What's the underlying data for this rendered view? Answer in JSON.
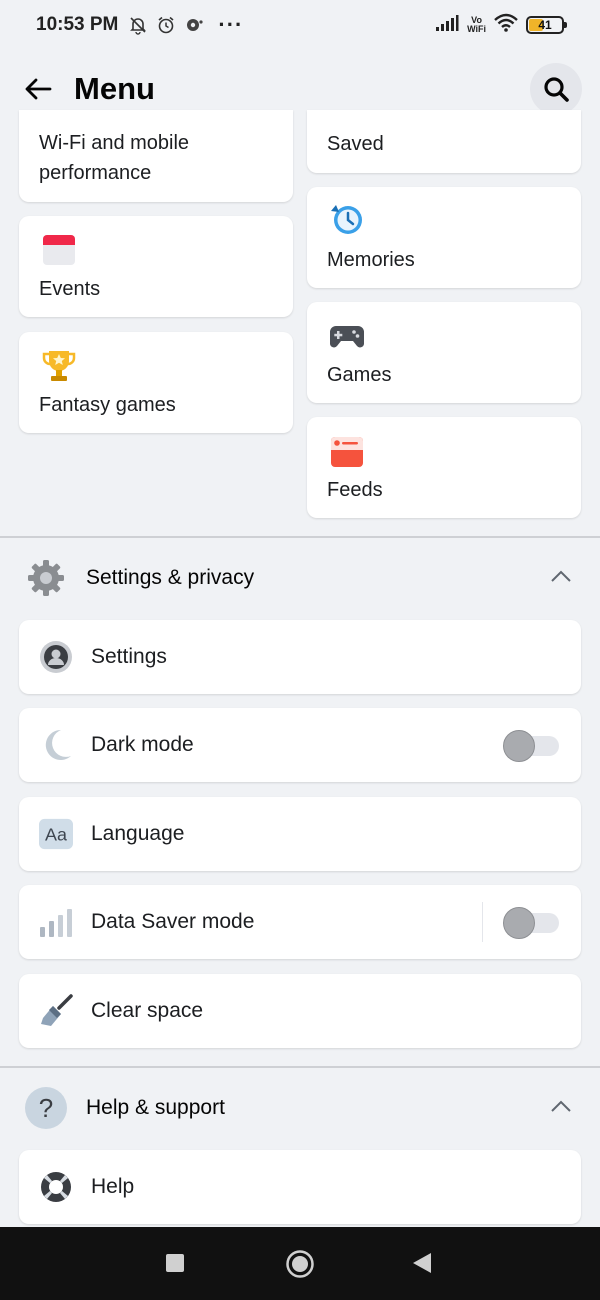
{
  "status_bar": {
    "time": "10:53 PM",
    "battery": "41",
    "vowifi_top": "Vo",
    "vowifi_bottom": "WiFi",
    "icons": [
      "mute-bell-icon",
      "alarm-icon",
      "notification-icon",
      "more-dots-icon",
      "signal-icon",
      "vowifi-icon",
      "wifi-icon",
      "battery-icon"
    ]
  },
  "header": {
    "title": "Menu"
  },
  "shortcuts": {
    "left": [
      {
        "label": "Wi-Fi and mobile performance",
        "icon": "wifi-performance-icon"
      },
      {
        "label": "Events",
        "icon": "calendar-icon"
      },
      {
        "label": "Fantasy games",
        "icon": "trophy-icon"
      }
    ],
    "right": [
      {
        "label": "Saved",
        "icon": "bookmark-icon"
      },
      {
        "label": "Memories",
        "icon": "clock-history-icon"
      },
      {
        "label": "Games",
        "icon": "gamepad-icon"
      },
      {
        "label": "Feeds",
        "icon": "feeds-icon"
      }
    ]
  },
  "settings_section": {
    "title": "Settings & privacy",
    "items": [
      {
        "label": "Settings",
        "icon": "account-icon"
      },
      {
        "label": "Dark mode",
        "icon": "moon-icon",
        "toggle": false
      },
      {
        "label": "Language",
        "icon": "language-icon",
        "icon_text": "Aa"
      },
      {
        "label": "Data Saver mode",
        "icon": "data-bars-icon",
        "toggle": false
      },
      {
        "label": "Clear space",
        "icon": "broom-icon"
      }
    ]
  },
  "help_section": {
    "title": "Help & support",
    "items": [
      {
        "label": "Help",
        "icon": "lifebuoy-icon"
      }
    ]
  },
  "colors": {
    "background": "#f0f2f5",
    "card": "#ffffff",
    "accent_blue": "#1877f2",
    "events_red": "#f02849",
    "trophy_gold": "#f7b928",
    "feeds_orange": "#f5533d"
  }
}
